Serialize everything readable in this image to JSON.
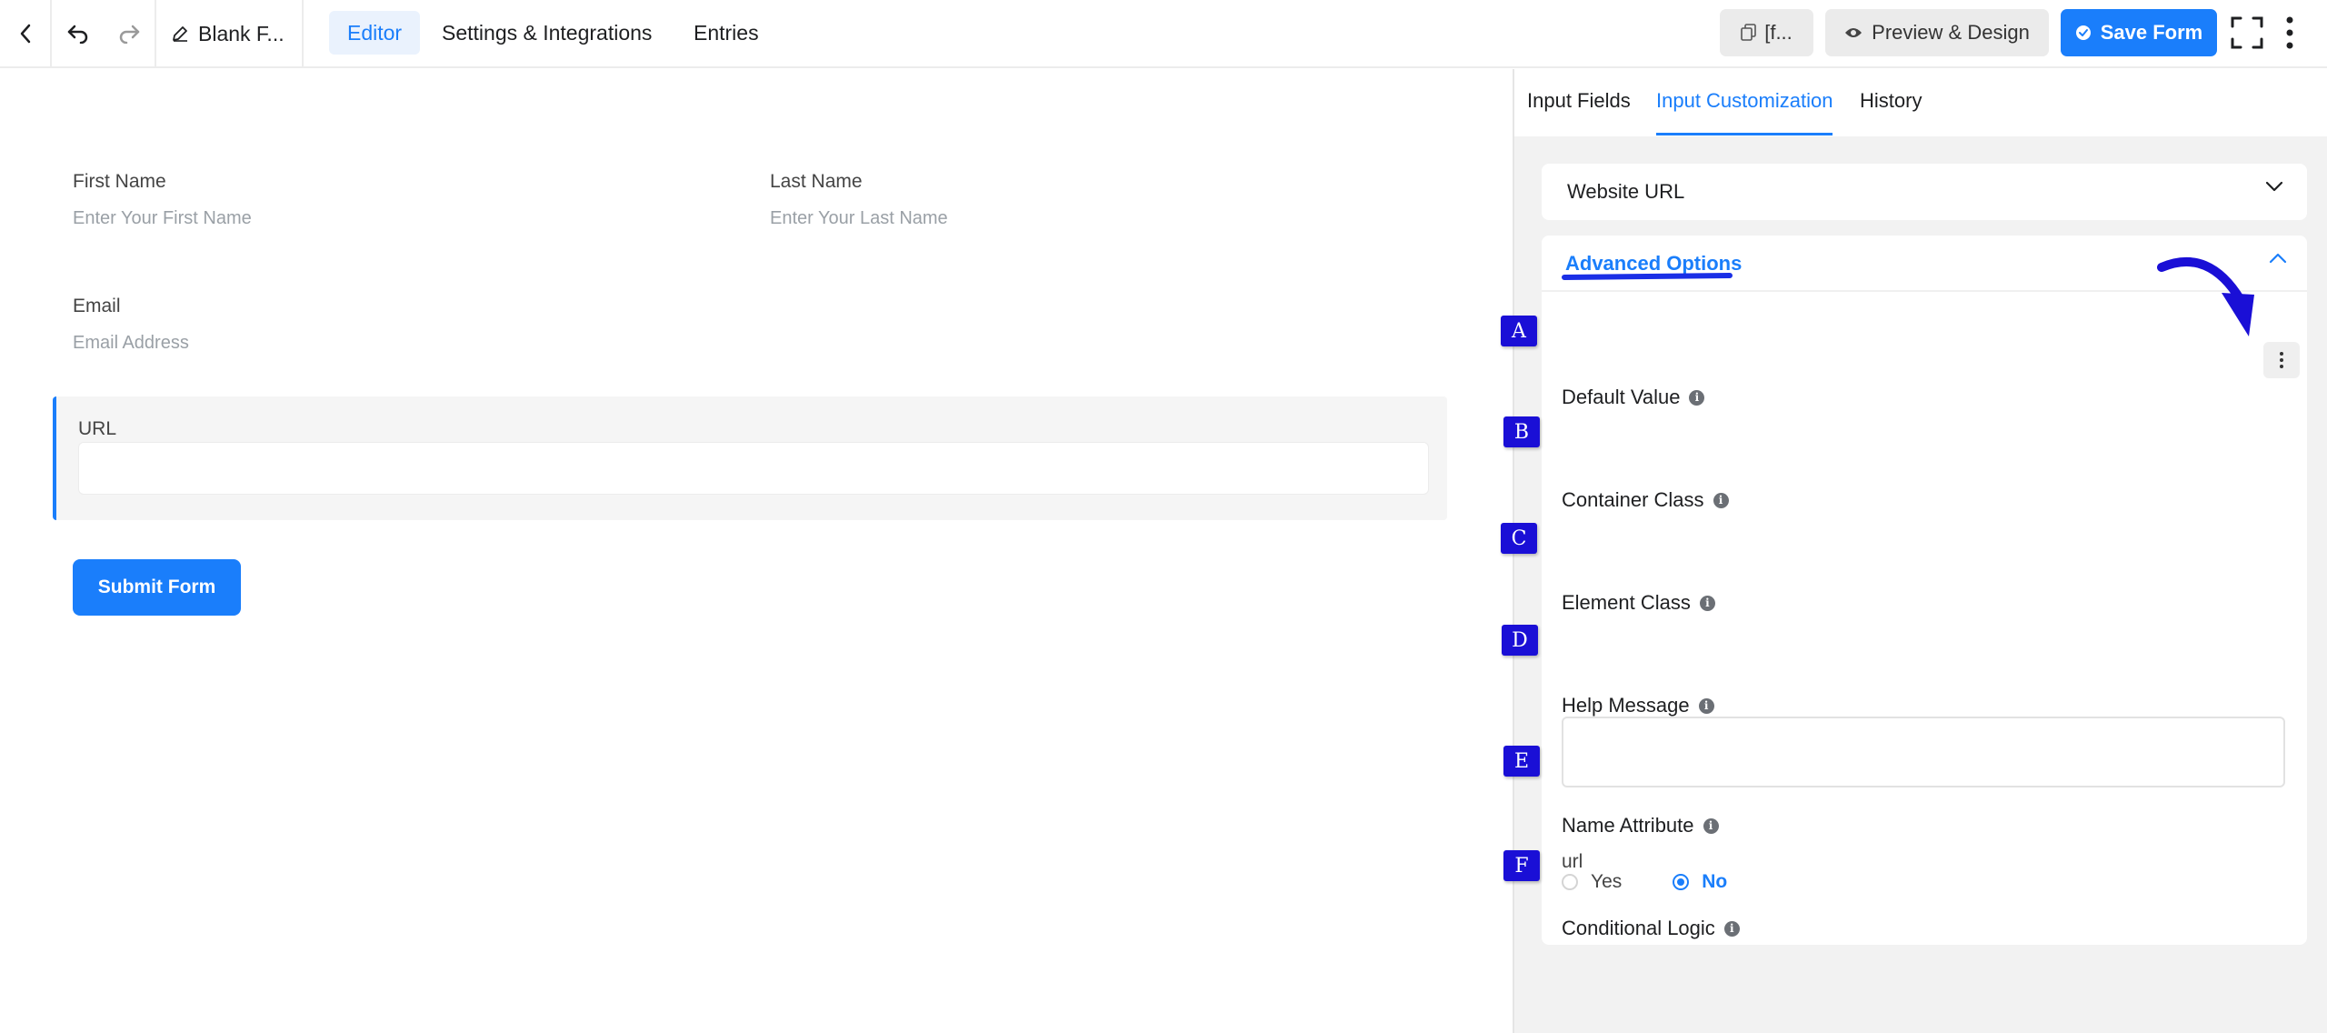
{
  "topbar": {
    "form_title": "Blank F...",
    "tabs": [
      {
        "label": "Editor",
        "active": true
      },
      {
        "label": "Settings & Integrations",
        "active": false
      },
      {
        "label": "Entries",
        "active": false
      }
    ],
    "shortcode_label": "[f...",
    "preview_label": "Preview & Design",
    "save_label": "Save Form"
  },
  "form": {
    "first_name": {
      "label": "First Name",
      "placeholder": "Enter Your First Name"
    },
    "last_name": {
      "label": "Last Name",
      "placeholder": "Enter Your Last Name"
    },
    "email": {
      "label": "Email",
      "placeholder": "Email Address"
    },
    "url": {
      "label": "URL",
      "value": ""
    },
    "submit_label": "Submit Form"
  },
  "panel": {
    "tabs": [
      {
        "label": "Input Fields",
        "active": false
      },
      {
        "label": "Input Customization",
        "active": true
      },
      {
        "label": "History",
        "active": false
      }
    ],
    "field_section_title": "Website URL",
    "advanced_title": "Advanced Options",
    "options": {
      "default_value": "Default Value",
      "container_class": "Container Class",
      "element_class": "Element Class",
      "help_message": "Help Message",
      "name_attribute": "Name Attribute",
      "name_attribute_value": "url",
      "conditional_logic": "Conditional Logic",
      "conditional_yes": "Yes",
      "conditional_no": "No",
      "conditional_selected": "No"
    },
    "info_glyph": "i"
  },
  "annotations": {
    "badges": [
      "A",
      "B",
      "C",
      "D",
      "E",
      "F"
    ]
  },
  "colors": {
    "accent": "#1a7efb",
    "annotation": "#1a0fd6"
  }
}
